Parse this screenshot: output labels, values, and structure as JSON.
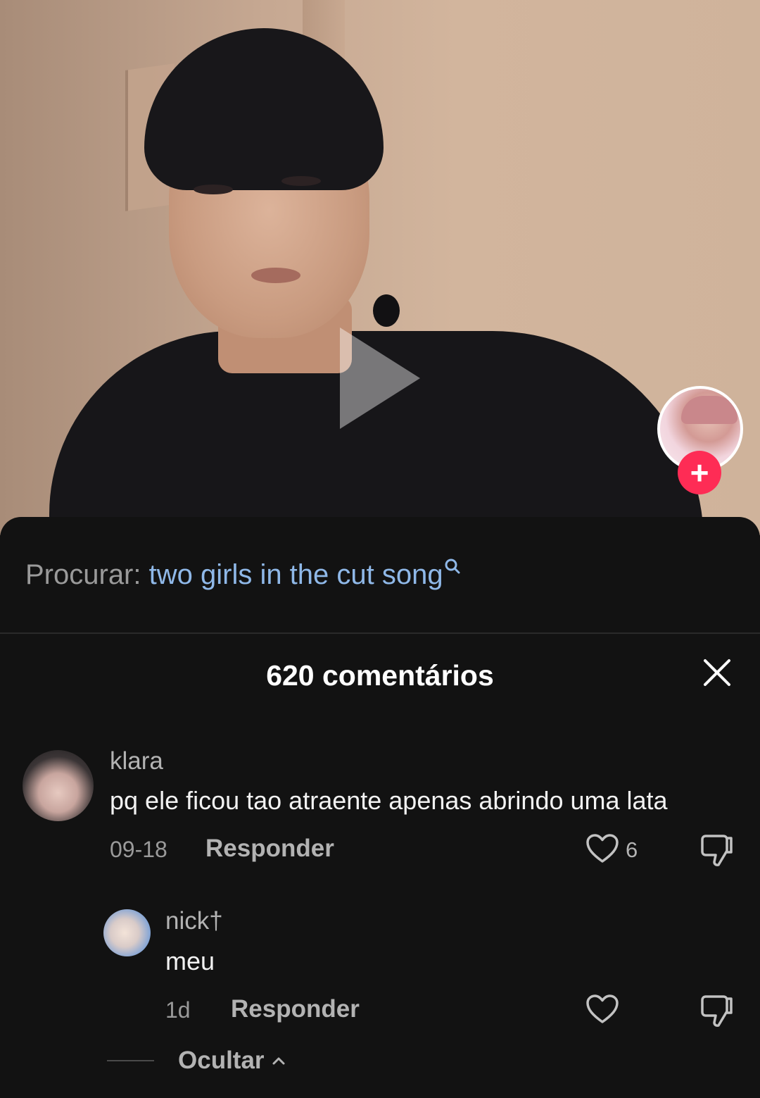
{
  "video": {
    "play_icon": "play-icon",
    "creator_follow_symbol": "+"
  },
  "search": {
    "prefix": "Procurar:",
    "term": "two girls in the cut song",
    "icon": "search-icon"
  },
  "comments_header": {
    "title": "620 comentários",
    "close_icon": "close-icon"
  },
  "comments": [
    {
      "username": "klara",
      "text": "pq ele ficou tao atraente apenas abrindo uma lata",
      "date": "09-18",
      "reply_label": "Responder",
      "likes": "6"
    }
  ],
  "replies": [
    {
      "username": "nick†",
      "text": "meu",
      "date": "1d",
      "reply_label": "Responder"
    }
  ],
  "hide_label": "Ocultar",
  "colors": {
    "background": "#121212",
    "search_term": "#8fb8e8",
    "follow_button": "#fe2c55"
  }
}
